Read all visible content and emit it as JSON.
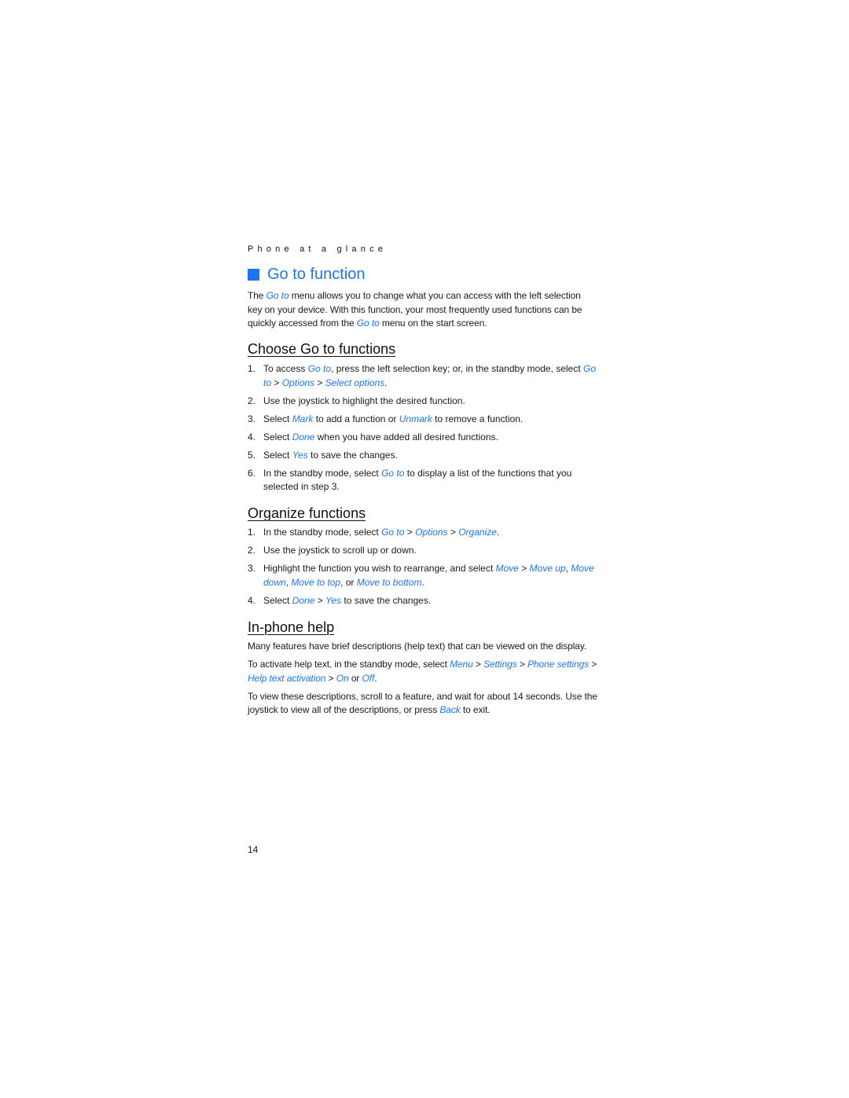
{
  "header": {
    "section_label": "Phone at a glance"
  },
  "title": "Go to function",
  "accent_color": "#1a75ff",
  "intro": [
    {
      "t": "The "
    },
    {
      "l": "Go to"
    },
    {
      "t": " menu allows you to change what you can access with the left selection key on your device. With this function, your most frequently used functions can be quickly accessed from the "
    },
    {
      "l": "Go to"
    },
    {
      "t": " menu on the start screen."
    }
  ],
  "sections": [
    {
      "heading": "Choose Go to functions",
      "steps": [
        [
          {
            "t": "To access "
          },
          {
            "l": "Go to"
          },
          {
            "t": ", press the left selection key; or, in the standby mode, select "
          },
          {
            "l": "Go to"
          },
          {
            "t": " > "
          },
          {
            "l": "Options"
          },
          {
            "t": " > "
          },
          {
            "l": "Select options"
          },
          {
            "t": "."
          }
        ],
        [
          {
            "t": "Use the joystick to highlight the desired function."
          }
        ],
        [
          {
            "t": "Select "
          },
          {
            "l": "Mark"
          },
          {
            "t": " to add a function or "
          },
          {
            "l": "Unmark"
          },
          {
            "t": " to remove a function."
          }
        ],
        [
          {
            "t": "Select "
          },
          {
            "l": "Done"
          },
          {
            "t": " when you have added all desired functions."
          }
        ],
        [
          {
            "t": "Select "
          },
          {
            "l": "Yes"
          },
          {
            "t": " to save the changes."
          }
        ],
        [
          {
            "t": "In the standby mode, select "
          },
          {
            "l": "Go to"
          },
          {
            "t": " to display a list of the functions that you selected in step 3."
          }
        ]
      ]
    },
    {
      "heading": "Organize functions",
      "steps": [
        [
          {
            "t": "In the standby mode, select "
          },
          {
            "l": "Go to"
          },
          {
            "t": " > "
          },
          {
            "l": "Options"
          },
          {
            "t": " > "
          },
          {
            "l": "Organize"
          },
          {
            "t": "."
          }
        ],
        [
          {
            "t": "Use the joystick to scroll up or down."
          }
        ],
        [
          {
            "t": "Highlight the function you wish to rearrange, and select "
          },
          {
            "l": "Move"
          },
          {
            "t": " > "
          },
          {
            "l": "Move up"
          },
          {
            "t": ", "
          },
          {
            "l": "Move down"
          },
          {
            "t": ", "
          },
          {
            "l": "Move to top"
          },
          {
            "t": ", or "
          },
          {
            "l": "Move to bottom"
          },
          {
            "t": "."
          }
        ],
        [
          {
            "t": "Select "
          },
          {
            "l": "Done"
          },
          {
            "t": " > "
          },
          {
            "l": "Yes"
          },
          {
            "t": " to save the changes."
          }
        ]
      ]
    },
    {
      "heading": "In-phone help",
      "paragraphs": [
        [
          {
            "t": "Many features have brief descriptions (help text) that can be viewed on the display."
          }
        ],
        [
          {
            "t": "To activate help text, in the standby mode, select "
          },
          {
            "l": "Menu"
          },
          {
            "t": " > "
          },
          {
            "l": "Settings"
          },
          {
            "t": " > "
          },
          {
            "l": "Phone settings"
          },
          {
            "t": " > "
          },
          {
            "l": "Help text activation"
          },
          {
            "t": " > "
          },
          {
            "l": "On"
          },
          {
            "t": " or "
          },
          {
            "l": "Off"
          },
          {
            "t": "."
          }
        ],
        [
          {
            "t": "To view these descriptions, scroll to a feature, and wait for about 14 seconds. Use the joystick to view all of the descriptions, or press "
          },
          {
            "l": "Back"
          },
          {
            "t": " to exit."
          }
        ]
      ]
    }
  ],
  "page_number": "14"
}
